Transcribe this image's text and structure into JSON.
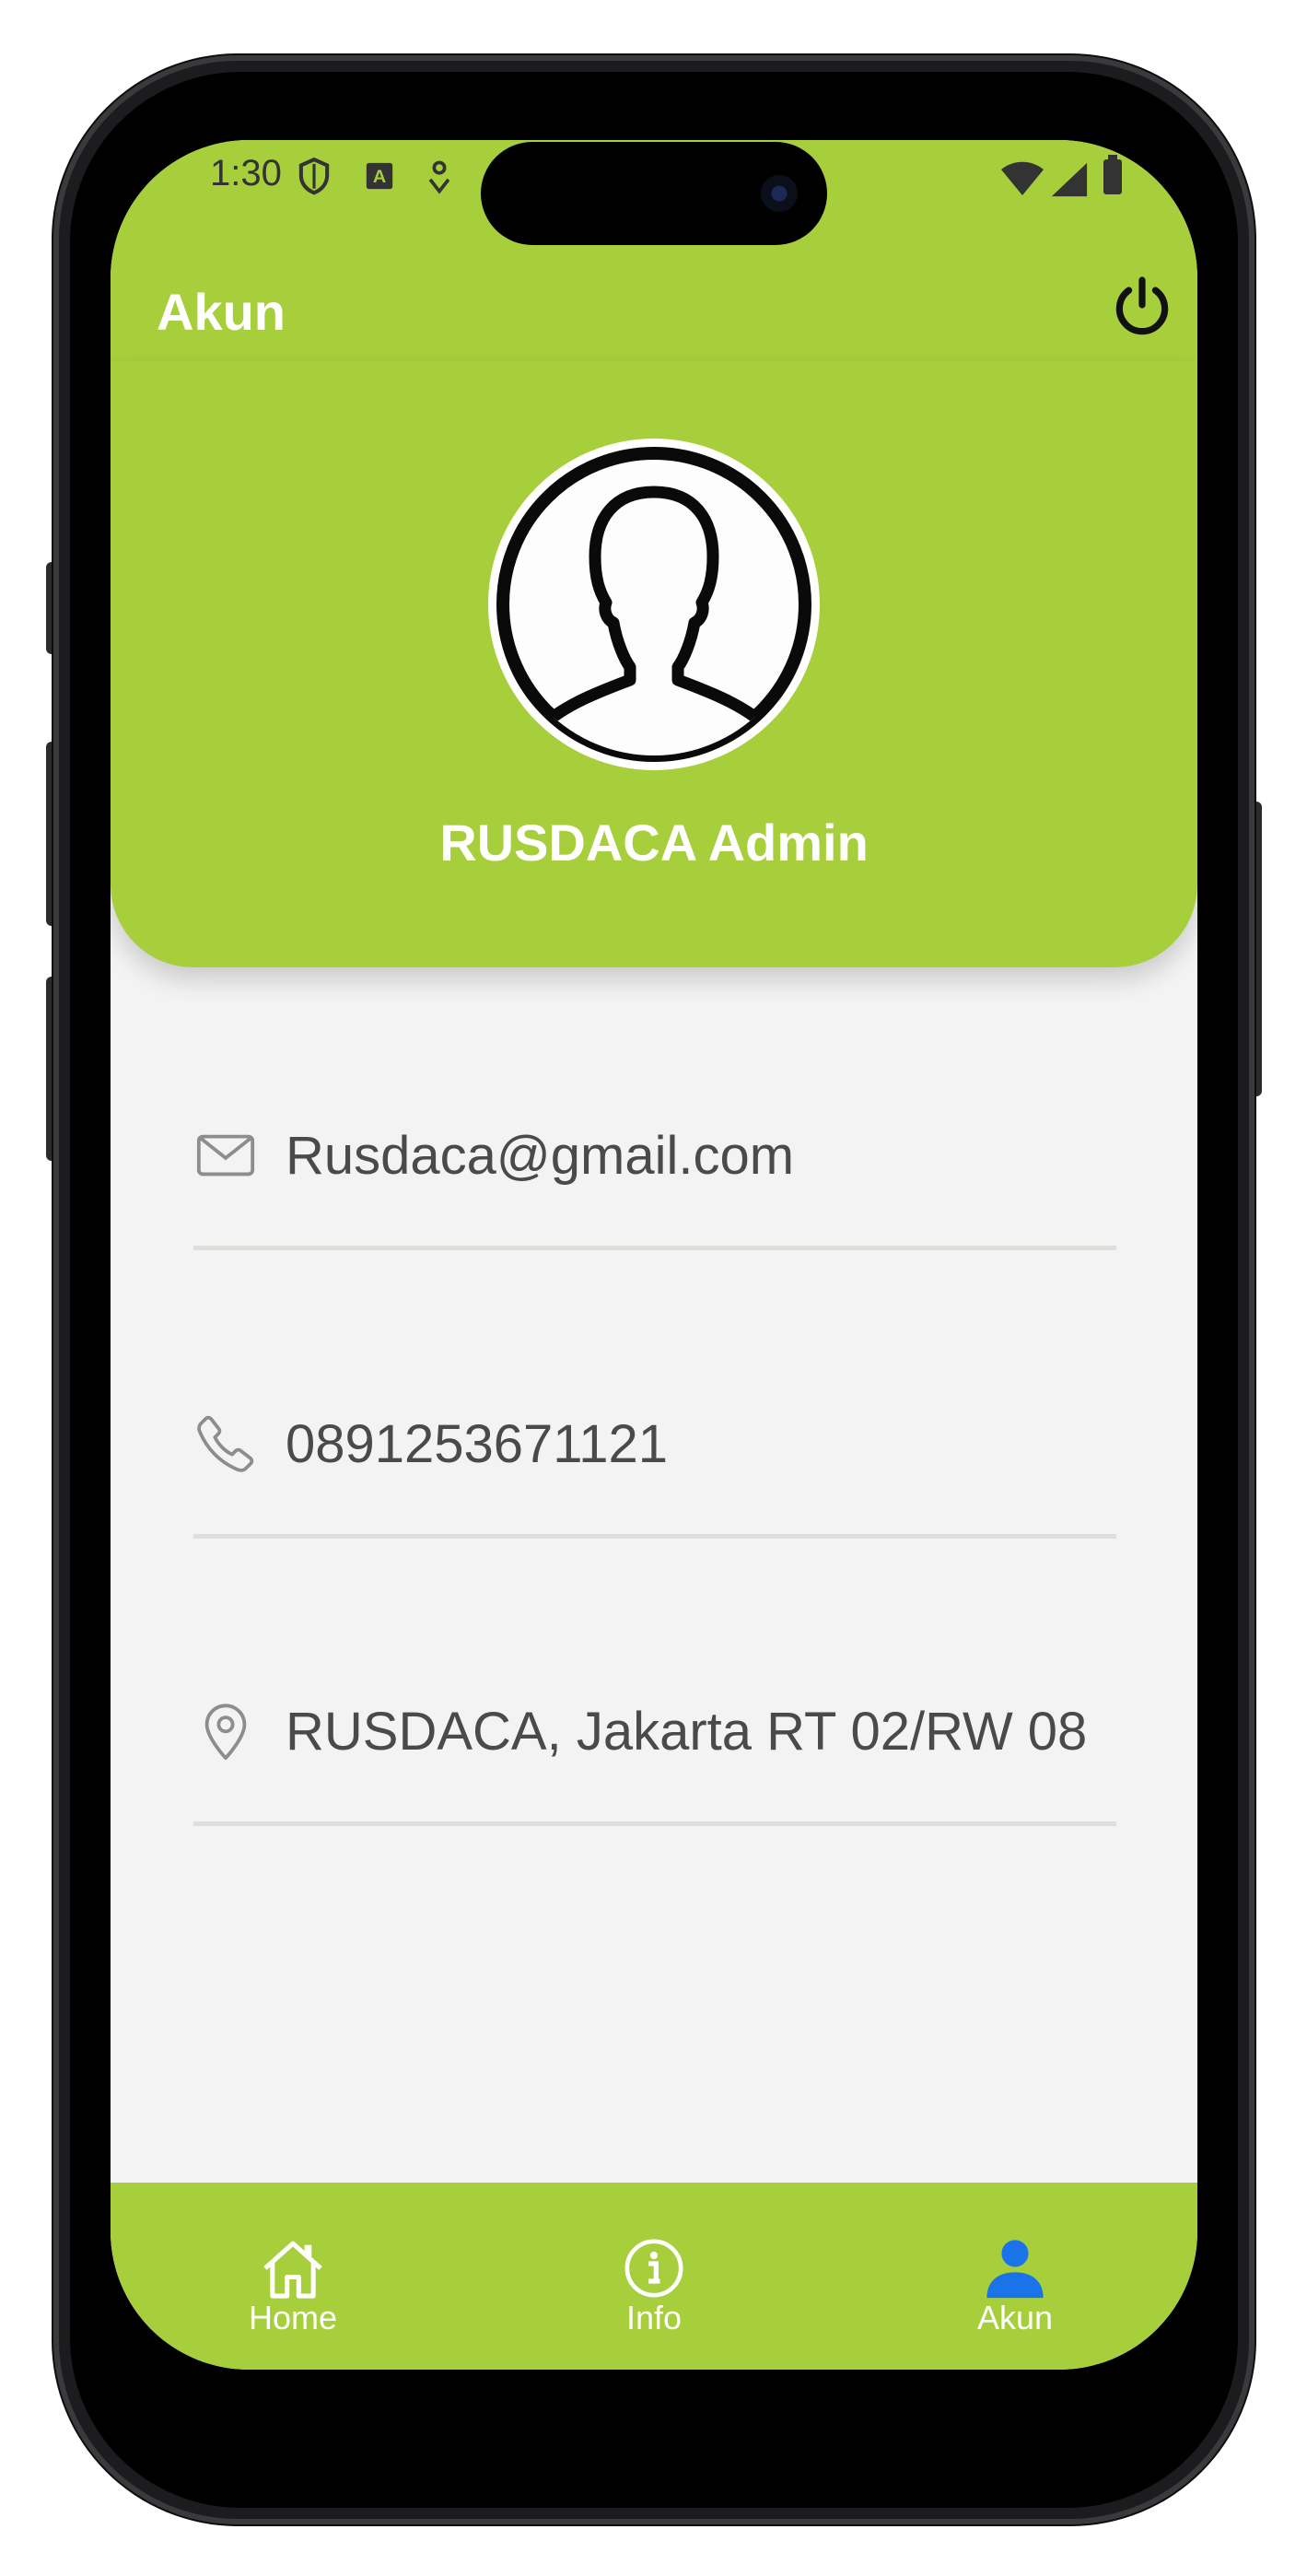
{
  "status_bar": {
    "time": "1:30",
    "icons": [
      "shield-icon",
      "a-box-icon",
      "location-pin-icon",
      "wifi-icon",
      "signal-icon",
      "battery-icon"
    ]
  },
  "app_bar": {
    "title": "Akun",
    "power_icon": "power-icon"
  },
  "profile": {
    "name": "RUSDACA Admin",
    "avatar_icon": "user-silhouette-icon"
  },
  "info": {
    "email": {
      "icon": "mail-icon",
      "value": "Rusdaca@gmail.com"
    },
    "phone": {
      "icon": "phone-icon",
      "value": "0891253671121"
    },
    "address": {
      "icon": "location-pin-icon",
      "value": "RUSDACA, Jakarta RT 02/RW 08"
    }
  },
  "bottom_nav": {
    "items": [
      {
        "label": "Home",
        "icon": "home-icon",
        "active": false
      },
      {
        "label": "Info",
        "icon": "info-icon",
        "active": false
      },
      {
        "label": "Akun",
        "icon": "person-icon",
        "active": true
      }
    ]
  },
  "colors": {
    "brand": "#a7ce3b",
    "active_nav": "#1a73e8",
    "background": "#f3f3f3",
    "text": "#4a4a4a"
  }
}
